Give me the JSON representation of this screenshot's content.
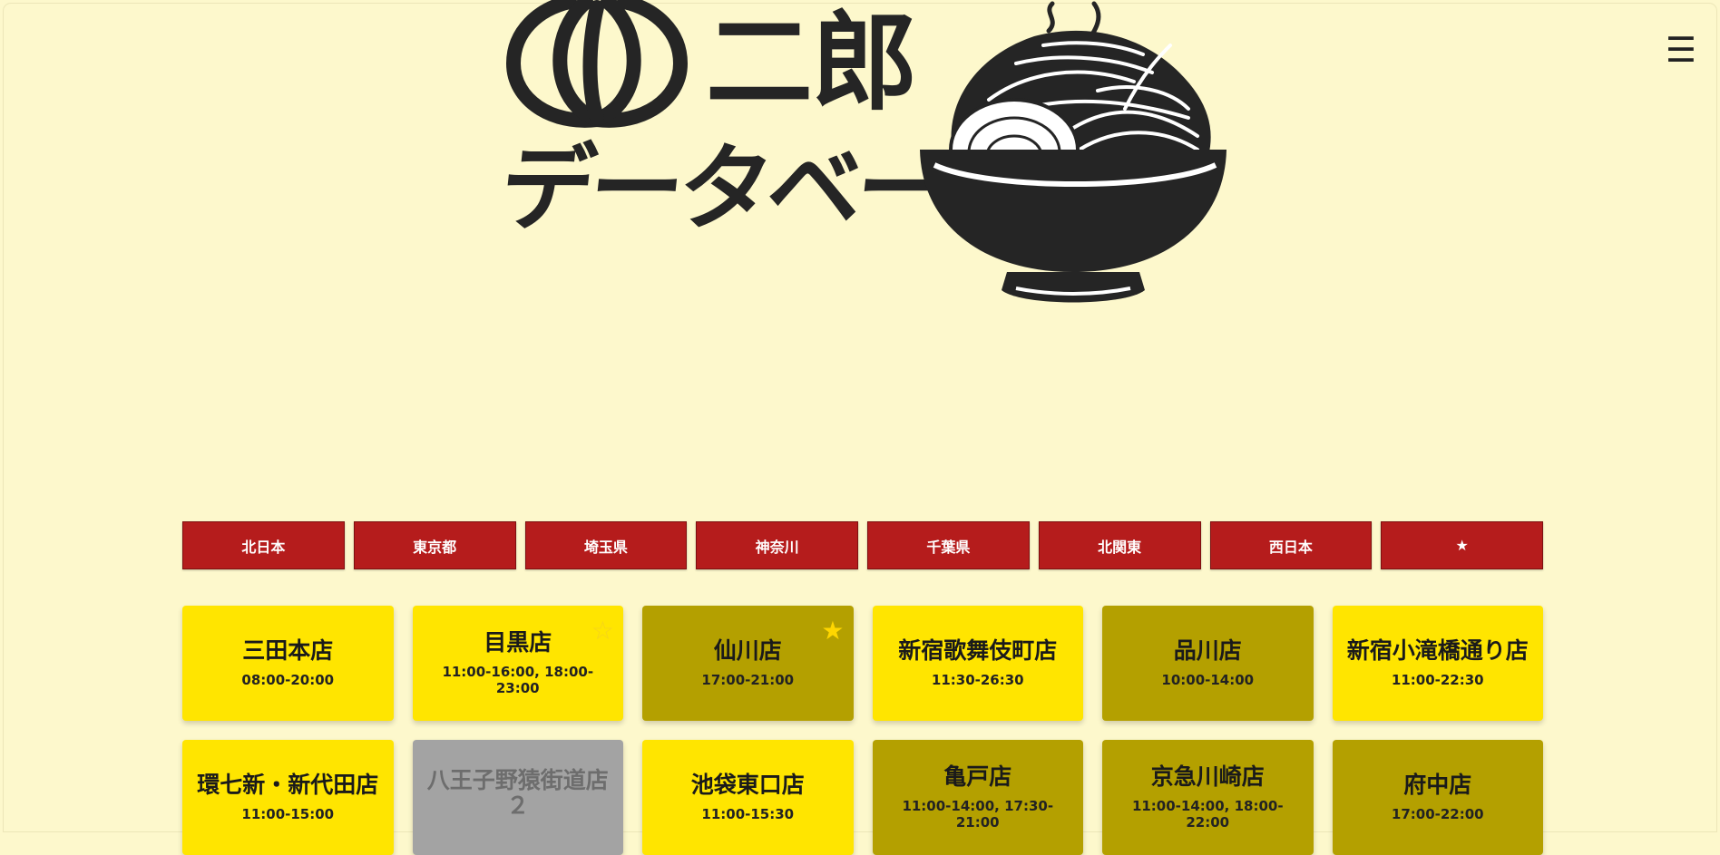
{
  "header": {
    "logo_title": "二郎",
    "logo_subtitle": "データベース",
    "menu_icon": "☰"
  },
  "colors": {
    "background": "#fdf8cc",
    "region_button": "#b51c1c",
    "shop_open": "#ffe500",
    "shop_closed": "#b4a000",
    "shop_inactive": "#a3a3a3",
    "logo_dark": "#252525"
  },
  "regions": [
    {
      "label": "北日本"
    },
    {
      "label": "東京都"
    },
    {
      "label": "埼玉県"
    },
    {
      "label": "神奈川"
    },
    {
      "label": "千葉県"
    },
    {
      "label": "北関東"
    },
    {
      "label": "西日本"
    },
    {
      "label": "★"
    }
  ],
  "shops": [
    {
      "name": "三田本店",
      "hours": "08:00-20:00",
      "status": "open",
      "favorite": "none"
    },
    {
      "name": "目黒店",
      "hours": "11:00-16:00, 18:00-23:00",
      "status": "open",
      "favorite": "outline",
      "star": "☆"
    },
    {
      "name": "仙川店",
      "hours": "17:00-21:00",
      "status": "closed",
      "favorite": "filled",
      "star": "★"
    },
    {
      "name": "新宿歌舞伎町店",
      "hours": "11:30-26:30",
      "status": "open",
      "favorite": "none"
    },
    {
      "name": "品川店",
      "hours": "10:00-14:00",
      "status": "closed",
      "favorite": "none"
    },
    {
      "name": "新宿小滝橋通り店",
      "hours": "11:00-22:30",
      "status": "open",
      "favorite": "none"
    },
    {
      "name": "環七新・新代田店",
      "hours": "11:00-15:00",
      "status": "open",
      "favorite": "none"
    },
    {
      "name": "八王子野猿街道店２",
      "hours": "",
      "status": "inactive",
      "favorite": "none"
    },
    {
      "name": "池袋東口店",
      "hours": "11:00-15:30",
      "status": "open",
      "favorite": "none"
    },
    {
      "name": "亀戸店",
      "hours": "11:00-14:00, 17:30-21:00",
      "status": "closed",
      "favorite": "none"
    },
    {
      "name": "京急川崎店",
      "hours": "11:00-14:00, 18:00-22:00",
      "status": "closed",
      "favorite": "none"
    },
    {
      "name": "府中店",
      "hours": "17:00-22:00",
      "status": "closed",
      "favorite": "none"
    }
  ]
}
